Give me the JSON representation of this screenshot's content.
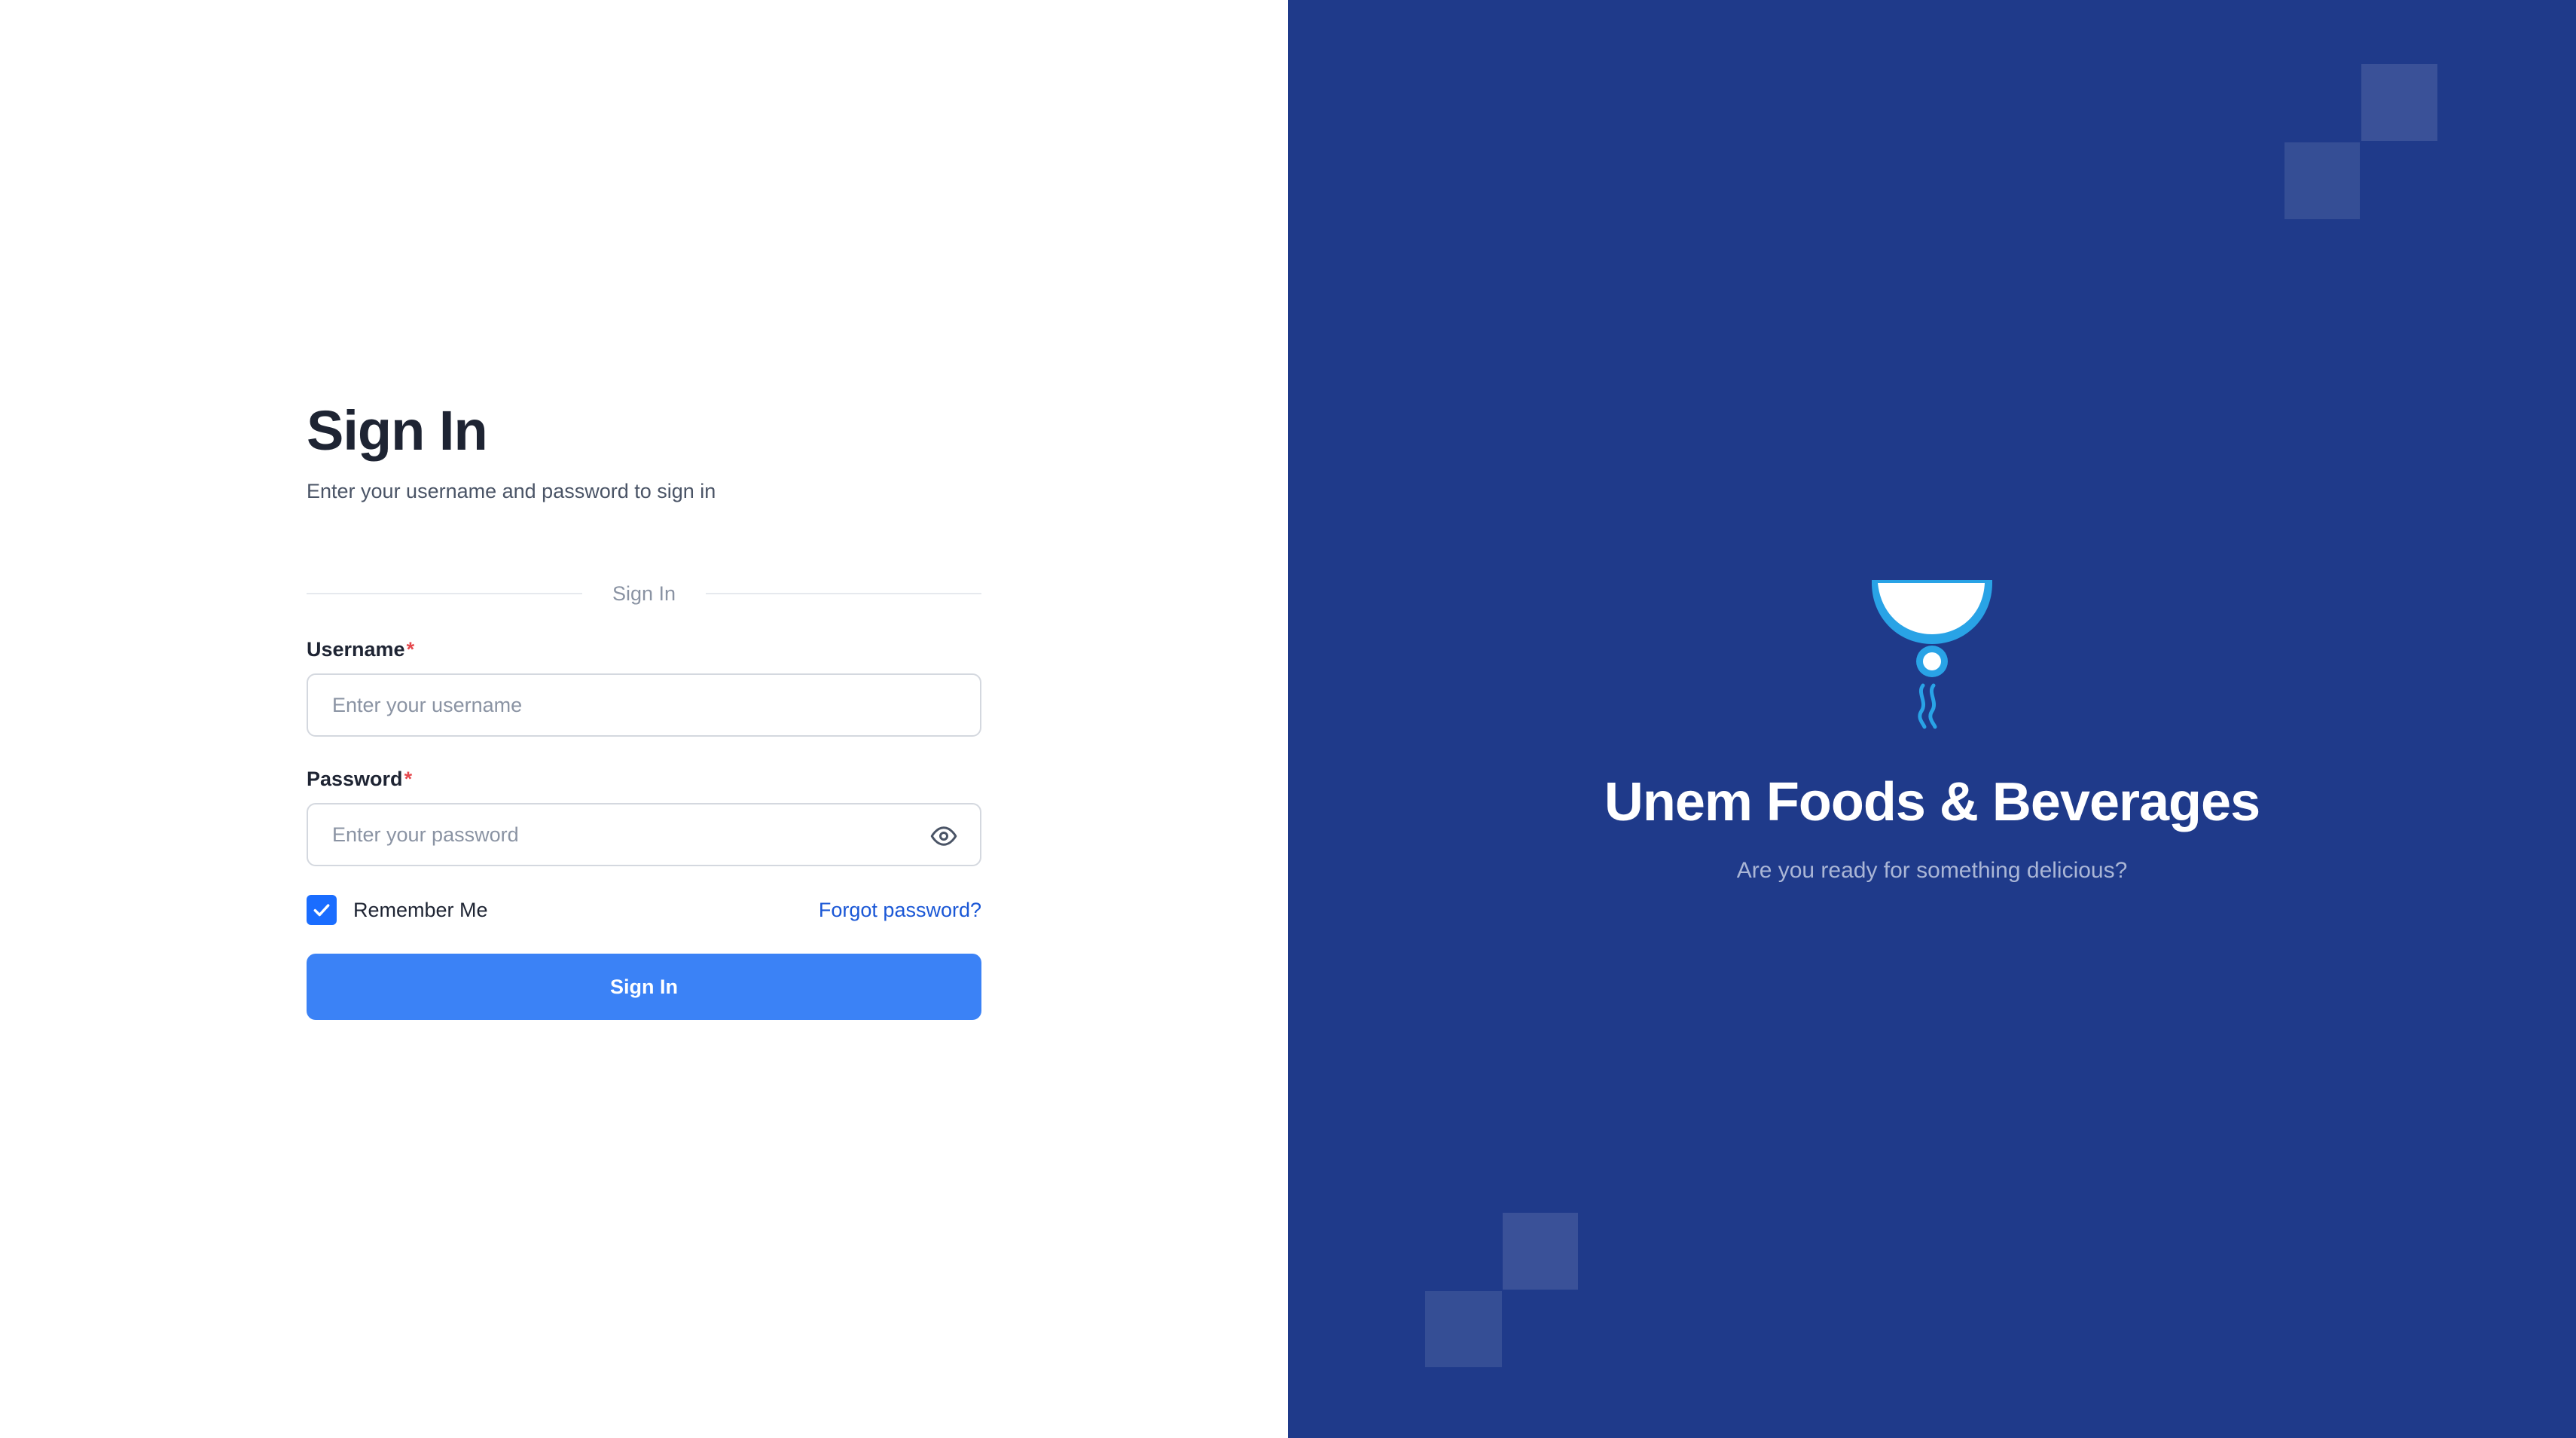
{
  "signin": {
    "title": "Sign In",
    "subtitle": "Enter your username and password to sign in",
    "divider_label": "Sign In",
    "username": {
      "label": "Username",
      "required_mark": "*",
      "placeholder": "Enter your username",
      "value": ""
    },
    "password": {
      "label": "Password",
      "required_mark": "*",
      "placeholder": "Enter your password",
      "value": "",
      "toggle_icon": "eye-icon"
    },
    "remember_me": {
      "label": "Remember Me",
      "checked": true
    },
    "forgot_password": "Forgot password?",
    "submit_label": "Sign In"
  },
  "brand": {
    "logo_icon": "bowl-logo-icon",
    "name": "Unem Foods & Beverages",
    "tagline": "Are you ready for something delicious?"
  },
  "colors": {
    "primary": "#3b82f6",
    "checkbox": "#1a6dff",
    "link": "#1a57d6",
    "panel_bg": "#1f3a8a",
    "required": "#e5484d",
    "logo_accent": "#29a3e6"
  }
}
